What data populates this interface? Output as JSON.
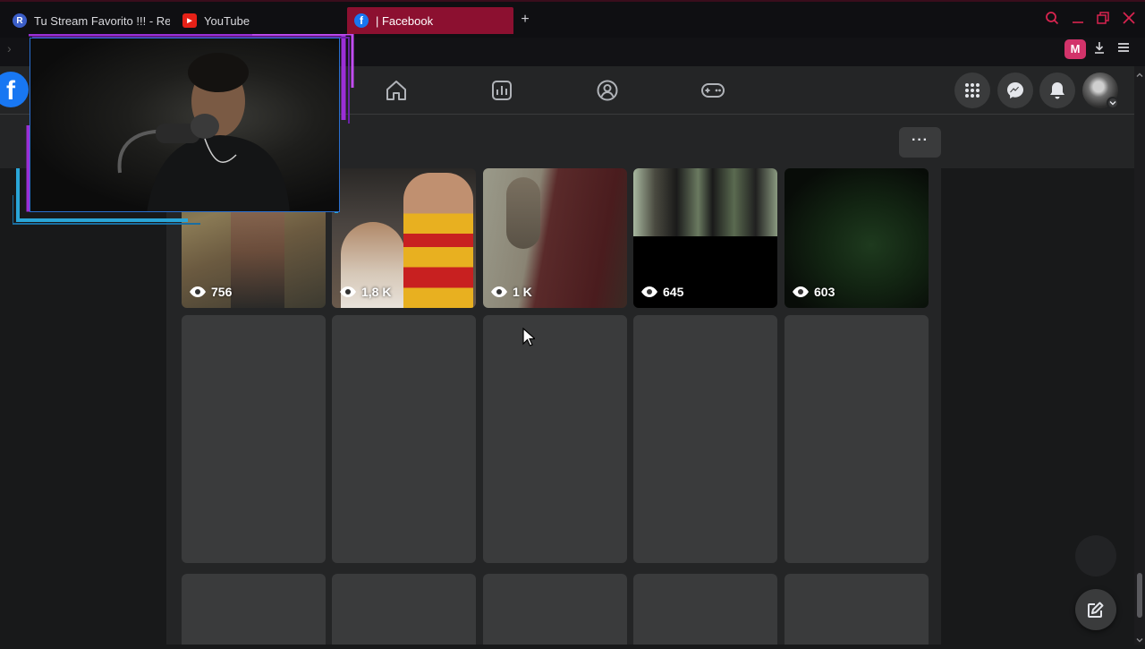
{
  "browser": {
    "tabs": [
      {
        "title": "Tu Stream Favorito !!! - Re",
        "favicon": "R",
        "favicon_color": "#3b5ec8",
        "active": false
      },
      {
        "title": "YouTube",
        "favicon": "▶",
        "favicon_color": "#e62117",
        "active": false
      },
      {
        "title": "| Facebook",
        "favicon": "f",
        "favicon_color": "#1877f2",
        "active": true
      }
    ],
    "new_tab_label": "+",
    "extension_label": "M",
    "accent_color": "#d8244f"
  },
  "facebook": {
    "logo": "f",
    "nav_icons": [
      "home-icon",
      "dashboard-icon",
      "groups-icon",
      "gaming-icon"
    ],
    "right_icons": [
      "menu-grid-icon",
      "messenger-icon",
      "bell-icon"
    ],
    "more_label": "···"
  },
  "grid": {
    "row1": [
      {
        "views": "756",
        "thumb": "person-outdoors"
      },
      {
        "views": "1,8 K",
        "thumb": "two-people-jersey"
      },
      {
        "views": "1 K",
        "thumb": "person-red-shirt"
      },
      {
        "views": "645",
        "thumb": "three-people"
      },
      {
        "views": "603",
        "thumb": "dark-plants"
      }
    ]
  }
}
